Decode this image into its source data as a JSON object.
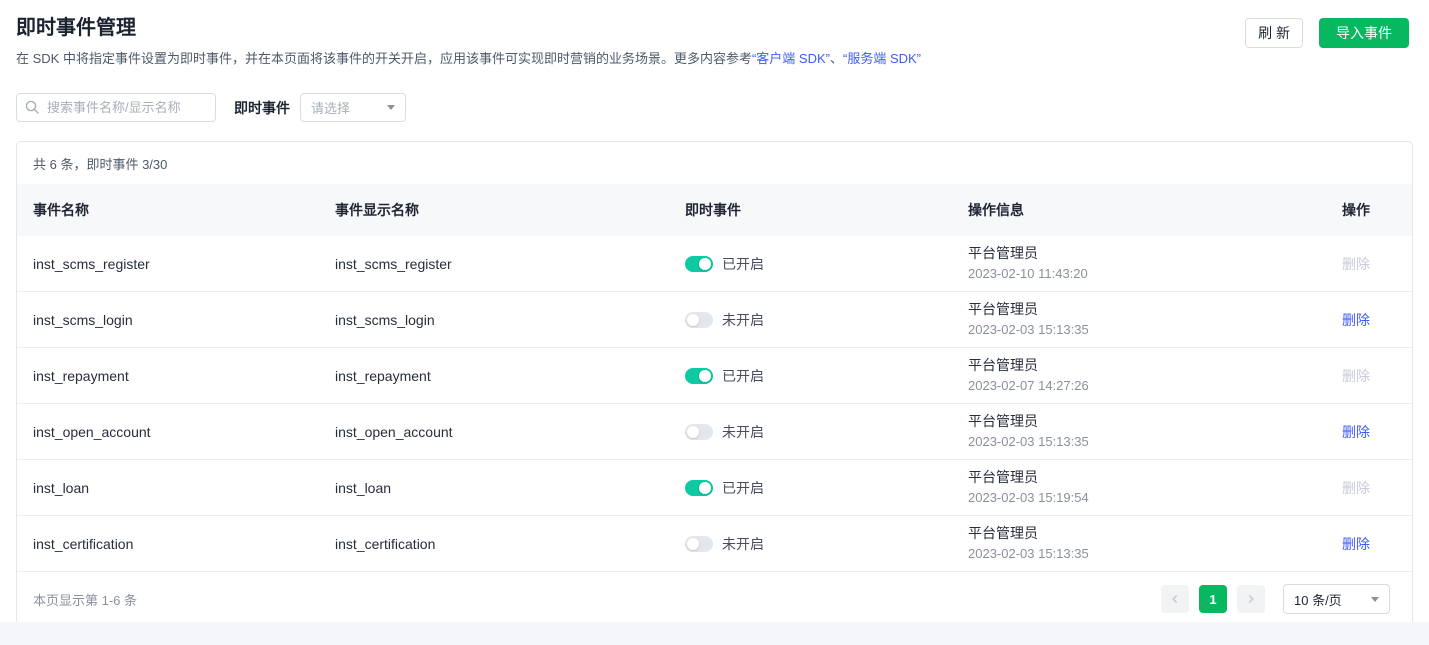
{
  "page": {
    "title": "即时事件管理",
    "subtitle_prefix": "在 SDK 中将指定事件设置为即时事件，并在本页面将该事件的开关开启，应用该事件可实现即时营销的业务场景。更多内容参考",
    "link_client_sdk": "“客户端 SDK”",
    "subtitle_separator": "、",
    "link_server_sdk": "“服务端 SDK”"
  },
  "toolbar": {
    "refresh_label": "刷 新",
    "import_label": "导入事件"
  },
  "filters": {
    "search_placeholder": "搜索事件名称/显示名称",
    "instant_event_label": "即时事件",
    "select_placeholder": "请选择"
  },
  "table": {
    "summary": "共 6 条，即时事件 3/30",
    "columns": [
      "事件名称",
      "事件显示名称",
      "即时事件",
      "操作信息",
      "操作"
    ],
    "toggle_on_label": "已开启",
    "toggle_off_label": "未开启",
    "delete_label": "删除",
    "rows": [
      {
        "name": "inst_scms_register",
        "display_name": "inst_scms_register",
        "enabled": true,
        "operator": "平台管理员",
        "time": "2023-02-10 11:43:20"
      },
      {
        "name": "inst_scms_login",
        "display_name": "inst_scms_login",
        "enabled": false,
        "operator": "平台管理员",
        "time": "2023-02-03 15:13:35"
      },
      {
        "name": "inst_repayment",
        "display_name": "inst_repayment",
        "enabled": true,
        "operator": "平台管理员",
        "time": "2023-02-07 14:27:26"
      },
      {
        "name": "inst_open_account",
        "display_name": "inst_open_account",
        "enabled": false,
        "operator": "平台管理员",
        "time": "2023-02-03 15:13:35"
      },
      {
        "name": "inst_loan",
        "display_name": "inst_loan",
        "enabled": true,
        "operator": "平台管理员",
        "time": "2023-02-03 15:19:54"
      },
      {
        "name": "inst_certification",
        "display_name": "inst_certification",
        "enabled": false,
        "operator": "平台管理员",
        "time": "2023-02-03 15:13:35"
      }
    ]
  },
  "pagination": {
    "range_text": "本页显示第 1-6 条",
    "current_page": "1",
    "page_size": "10 条/页"
  },
  "colors": {
    "accent_green": "#08b860",
    "toggle_green": "#0ec9a1",
    "link_blue": "#3b5df6",
    "header_bg": "#f7f8fa"
  }
}
